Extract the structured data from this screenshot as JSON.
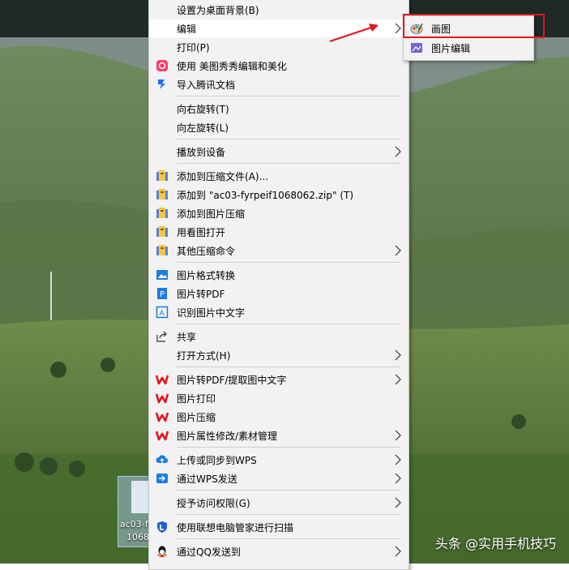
{
  "context_menu": {
    "items": [
      {
        "label": "设置为桌面背景(B)",
        "icon": "none",
        "submenu": false
      },
      {
        "label": "编辑",
        "icon": "none",
        "submenu": true,
        "active": true
      },
      {
        "label": "打印(P)",
        "icon": "none",
        "submenu": false
      },
      {
        "label": "使用 美图秀秀编辑和美化",
        "icon": "meitu-icon",
        "submenu": false
      },
      {
        "label": "导入腾讯文档",
        "icon": "tencent-docs-icon",
        "submenu": false
      },
      {
        "label": "向右旋转(T)",
        "icon": "none",
        "submenu": false
      },
      {
        "label": "向左旋转(L)",
        "icon": "none",
        "submenu": false
      },
      {
        "label": "播放到设备",
        "icon": "none",
        "submenu": true
      },
      {
        "label": "添加到压缩文件(A)...",
        "icon": "winrar-icon",
        "submenu": false
      },
      {
        "label": "添加到 \"ac03-fyrpeif1068062.zip\" (T)",
        "icon": "winrar-icon",
        "submenu": false
      },
      {
        "label": "添加到图片压缩",
        "icon": "winrar-icon",
        "submenu": false
      },
      {
        "label": "用看图打开",
        "icon": "winrar-icon",
        "submenu": false
      },
      {
        "label": "其他压缩命令",
        "icon": "winrar-icon",
        "submenu": true
      },
      {
        "label": "图片格式转换",
        "icon": "image-convert-icon",
        "submenu": false
      },
      {
        "label": "图片转PDF",
        "icon": "pdf-convert-icon",
        "submenu": false
      },
      {
        "label": "识别图片中文字",
        "icon": "ocr-icon",
        "submenu": false
      },
      {
        "label": "共享",
        "icon": "share-icon",
        "submenu": false
      },
      {
        "label": "打开方式(H)",
        "icon": "none",
        "submenu": true
      },
      {
        "label": "图片转PDF/提取图中文字",
        "icon": "wps-icon",
        "submenu": true
      },
      {
        "label": "图片打印",
        "icon": "wps-icon",
        "submenu": false
      },
      {
        "label": "图片压缩",
        "icon": "wps-icon",
        "submenu": false
      },
      {
        "label": "图片属性修改/素材管理",
        "icon": "wps-icon",
        "submenu": true
      },
      {
        "label": "上传或同步到WPS",
        "icon": "wps-cloud-icon",
        "submenu": true
      },
      {
        "label": "通过WPS发送",
        "icon": "wps-send-icon",
        "submenu": true
      },
      {
        "label": "授予访问权限(G)",
        "icon": "none",
        "submenu": true
      },
      {
        "label": "使用联想电脑管家进行扫描",
        "icon": "lenovo-shield-icon",
        "submenu": false
      },
      {
        "label": "通过QQ发送到",
        "icon": "qq-icon",
        "submenu": true
      }
    ]
  },
  "submenu": {
    "items": [
      {
        "label": "画图",
        "icon": "paint-icon"
      },
      {
        "label": "图片编辑",
        "icon": "photo-edit-icon"
      }
    ]
  },
  "desktop_icon": {
    "line1": "ac03-f",
    "line2": "1068"
  },
  "watermark": "头条 @实用手机技巧",
  "colors": {
    "highlight_box": "#e3141b",
    "menu_bg": "#f2f2f2",
    "wps_red": "#e3141b"
  }
}
